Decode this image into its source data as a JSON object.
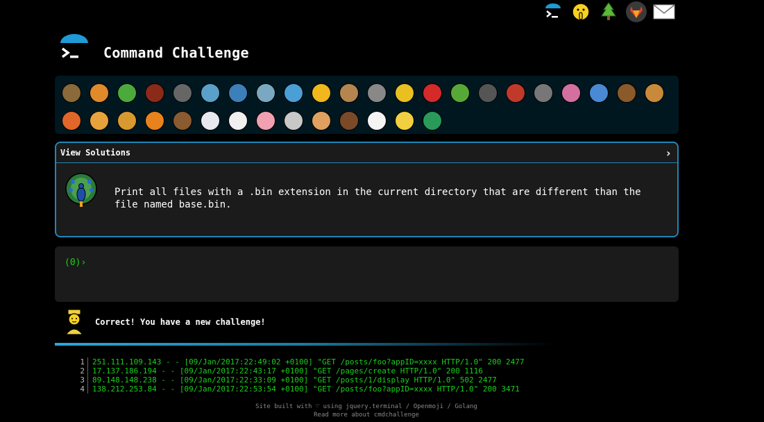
{
  "header": {
    "title": "Command Challenge"
  },
  "top_icons": [
    {
      "name": "terminal-icon"
    },
    {
      "name": "shushing-face-icon"
    },
    {
      "name": "tree-icon"
    },
    {
      "name": "gitlab-icon"
    },
    {
      "name": "mail-icon"
    }
  ],
  "animals": [
    {
      "name": "snail-icon",
      "color": "#8a6a3a"
    },
    {
      "name": "butterfly-icon",
      "color": "#e08a2c"
    },
    {
      "name": "caterpillar-icon",
      "color": "#4caa3c"
    },
    {
      "name": "ant-icon",
      "color": "#8a2a18"
    },
    {
      "name": "spider-web-icon",
      "color": "#666666"
    },
    {
      "name": "whale-icon",
      "color": "#5aa0c8"
    },
    {
      "name": "shark-icon",
      "color": "#3d7fb8"
    },
    {
      "name": "dolphin-icon",
      "color": "#7aa8c0"
    },
    {
      "name": "fish-icon",
      "color": "#4a9fd6"
    },
    {
      "name": "tropical-fish-icon",
      "color": "#f0b81c"
    },
    {
      "name": "blowfish-icon",
      "color": "#b58550"
    },
    {
      "name": "wolf-icon",
      "color": "#888888"
    },
    {
      "name": "bee-icon",
      "color": "#e8c020"
    },
    {
      "name": "ladybug-icon",
      "color": "#d42a2a"
    },
    {
      "name": "cricket-icon",
      "color": "#58a838"
    },
    {
      "name": "mosquito-icon",
      "color": "#555555"
    },
    {
      "name": "scorpion-icon",
      "color": "#c0392b"
    },
    {
      "name": "fly-icon",
      "color": "#777777"
    },
    {
      "name": "worm-icon",
      "color": "#d470a0"
    },
    {
      "name": "microbe-icon",
      "color": "#4a8ad4"
    },
    {
      "name": "monkey-icon",
      "color": "#8a5a2a"
    },
    {
      "name": "dog-icon",
      "color": "#c88a3a"
    },
    {
      "name": "fox-icon",
      "color": "#e0662a"
    },
    {
      "name": "cat-icon",
      "color": "#e8a23c"
    },
    {
      "name": "lion-icon",
      "color": "#d89a30"
    },
    {
      "name": "tiger-icon",
      "color": "#e8821c"
    },
    {
      "name": "horse-icon",
      "color": "#8a5a30"
    },
    {
      "name": "unicorn-icon",
      "color": "#e8e8f0"
    },
    {
      "name": "cow-icon",
      "color": "#f0f0f0"
    },
    {
      "name": "pig-icon",
      "color": "#f0a0b0"
    },
    {
      "name": "mouse-icon",
      "color": "#c8c8c8"
    },
    {
      "name": "hamster-icon",
      "color": "#e0a060"
    },
    {
      "name": "bear-icon",
      "color": "#7a4a28"
    },
    {
      "name": "panda-icon",
      "color": "#f4f4f4"
    },
    {
      "name": "chick-icon",
      "color": "#f0d040"
    },
    {
      "name": "peacock-icon",
      "color": "#2a9a5a"
    }
  ],
  "panel": {
    "view_solutions": "View Solutions",
    "chevron": "›",
    "challenge_text": "Print all files with a .bin extension in the current directory that are different than the file named base.bin."
  },
  "terminal": {
    "prompt": "(0)›"
  },
  "status": {
    "correct_message": "Correct! You have a new challenge!"
  },
  "log": {
    "rows": [
      {
        "num": "1",
        "text": "251.111.109.143 - - [09/Jan/2017:22:49:02 +0100] \"GET /posts/foo?appID=xxxx HTTP/1.0\" 200 2477"
      },
      {
        "num": "2",
        "text": "17.137.186.194 - - [09/Jan/2017:22:43:17 +0100] \"GET /pages/create HTTP/1.0\" 200 1116"
      },
      {
        "num": "3",
        "text": "89.148.148.238 - - [09/Jan/2017:22:33:09 +0100] \"GET /posts/1/display HTTP/1.0\" 502 2477"
      },
      {
        "num": "4",
        "text": "138.212.253.84 - - [09/Jan/2017:22:53:54 +0100] \"GET /posts/foo?appID=xxxx HTTP/1.0\" 200 3471"
      }
    ]
  },
  "footer": {
    "line1": "Site built with ♡ using jquery.terminal / Openmoji / Golang",
    "line2": "Read more about cmdchallenge"
  }
}
